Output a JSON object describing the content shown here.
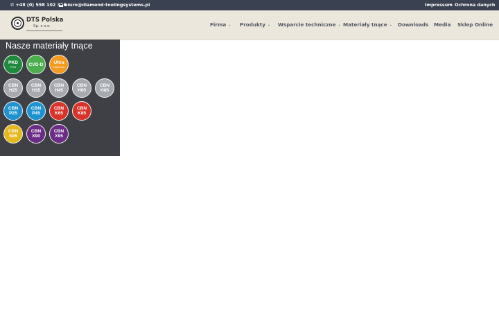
{
  "topbar": {
    "phone": "+48 (0) 598 102 356",
    "email": "biuro@diamond-toolingsystems.pl",
    "links": [
      "Impressum",
      "Ochrona danych"
    ]
  },
  "logo": {
    "name": "DTS Polska",
    "sub": "Sp. z o.o."
  },
  "nav": {
    "items": [
      {
        "label": "Firma",
        "dropdown": true
      },
      {
        "label": "Produkty",
        "dropdown": true
      },
      {
        "label": "Wsparcie techniczne",
        "dropdown": true
      },
      {
        "label": "Materiały tnące",
        "dropdown": true
      },
      {
        "label": "Downloads",
        "dropdown": false
      },
      {
        "label": "Media",
        "dropdown": false
      },
      {
        "label": "Sklep Online",
        "dropdown": false
      }
    ],
    "chevron": "⌄"
  },
  "materials": {
    "title": "Nasze materiały tnące",
    "items": [
      {
        "l1": "PKD",
        "l2": "PCD",
        "color": "#1f8a3d"
      },
      {
        "l1": "CVD-D",
        "l2": "",
        "color": "#4cae4f"
      },
      {
        "l1": "Ultra",
        "l2": "Diamond",
        "color": "#f39a21"
      },
      {
        "l1": "CBN",
        "l2": "H25",
        "color": "#a7a9b1"
      },
      {
        "l1": "CBN",
        "l2": "H35",
        "color": "#a7a9b1"
      },
      {
        "l1": "CBN",
        "l2": "H45",
        "color": "#a7a9b1"
      },
      {
        "l1": "CBN",
        "l2": "H65",
        "color": "#a7a9b1"
      },
      {
        "l1": "CBN",
        "l2": "H85",
        "color": "#a7a9b1"
      },
      {
        "l1": "CBN",
        "l2": "P25",
        "color": "#1e93d0"
      },
      {
        "l1": "CBN",
        "l2": "P45",
        "color": "#1e93d0"
      },
      {
        "l1": "CBN",
        "l2": "K65",
        "color": "#d8322b"
      },
      {
        "l1": "CBN",
        "l2": "K85",
        "color": "#d8322b"
      },
      {
        "l1": "CBN",
        "l2": "S85",
        "color": "#e5b81f"
      },
      {
        "l1": "CBN",
        "l2": "X90",
        "color": "#6b2c86"
      },
      {
        "l1": "CBN",
        "l2": "X95",
        "color": "#6b2c86"
      }
    ]
  },
  "colors": {
    "topbar_bg": "#3a4150",
    "header_bg": "#ece7dc",
    "panel_bg": "#3e4046",
    "nav_text": "#4e5563"
  }
}
